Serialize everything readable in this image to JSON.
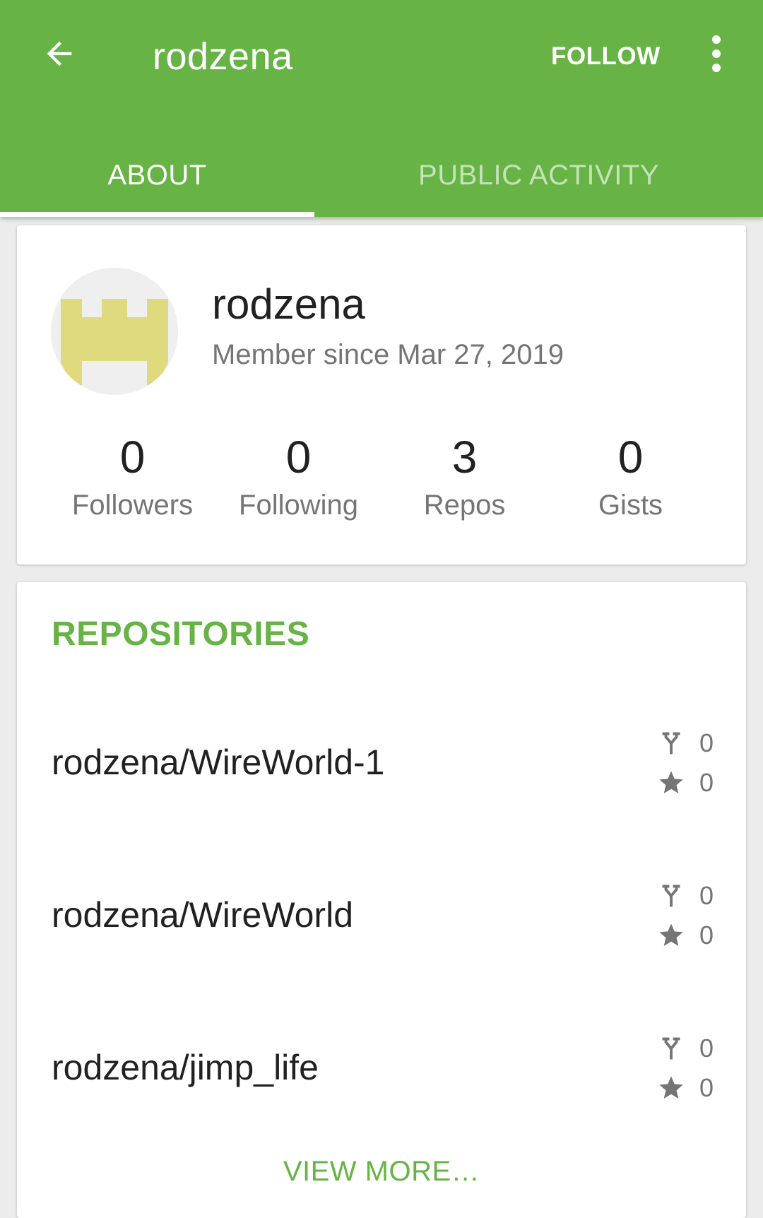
{
  "toolbar": {
    "title": "rodzena",
    "follow_label": "FOLLOW",
    "back_icon": "arrow-left-icon",
    "overflow_icon": "more-vertical-icon",
    "color": "#67b346"
  },
  "tabs": [
    {
      "label": "ABOUT",
      "selected": true
    },
    {
      "label": "PUBLIC ACTIVITY",
      "selected": false
    }
  ],
  "profile": {
    "username": "rodzena",
    "member_since": "Member since Mar 27, 2019",
    "avatar_icon": "identicon-avatar",
    "stats": [
      {
        "value": "0",
        "label": "Followers"
      },
      {
        "value": "0",
        "label": "Following"
      },
      {
        "value": "3",
        "label": "Repos"
      },
      {
        "value": "0",
        "label": "Gists"
      }
    ]
  },
  "repositories": {
    "title": "REPOSITORIES",
    "items": [
      {
        "name": "rodzena/WireWorld-1",
        "forks": "0",
        "stars": "0"
      },
      {
        "name": "rodzena/WireWorld",
        "forks": "0",
        "stars": "0"
      },
      {
        "name": "rodzena/jimp_life",
        "forks": "0",
        "stars": "0"
      }
    ],
    "view_more_label": "VIEW MORE…",
    "fork_icon": "fork-icon",
    "star_icon": "star-icon"
  },
  "colors": {
    "accent": "#67b346",
    "avatar_fill": "#e0da7e",
    "avatar_bg": "#efefef",
    "secondary_text": "#757575",
    "primary_text": "#212121"
  }
}
